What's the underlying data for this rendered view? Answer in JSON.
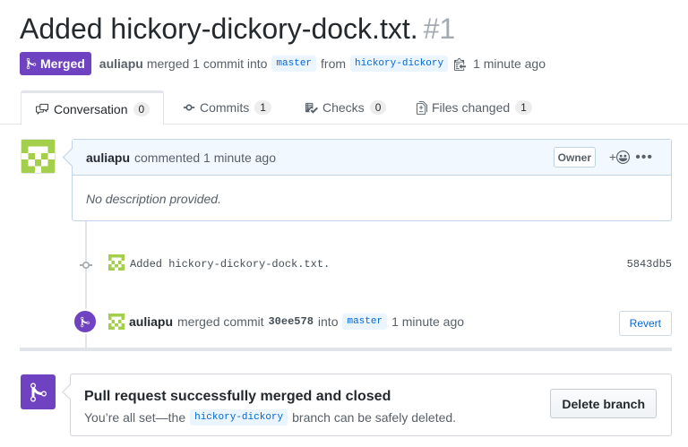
{
  "pr": {
    "title": "Added hickory-dickory-dock.txt.",
    "number": "#1",
    "state": "Merged",
    "author": "auliapu",
    "merge_summary": "merged 1 commit into",
    "base_branch": "master",
    "from_label": "from",
    "head_branch": "hickory-dickory",
    "time": "1 minute ago"
  },
  "tabs": [
    {
      "label": "Conversation",
      "count": "0",
      "icon": "comment-discussion-icon"
    },
    {
      "label": "Commits",
      "count": "1",
      "icon": "git-commit-icon"
    },
    {
      "label": "Checks",
      "count": "0",
      "icon": "checklist-icon"
    },
    {
      "label": "Files changed",
      "count": "1",
      "icon": "file-diff-icon"
    }
  ],
  "comment": {
    "author": "auliapu",
    "action": "commented 1 minute ago",
    "role": "Owner",
    "reaction_plus": "+",
    "body": "No description provided."
  },
  "commit": {
    "message": "Added hickory-dickory-dock.txt.",
    "sha": "5843db5"
  },
  "merge_event": {
    "author": "auliapu",
    "action": "merged commit",
    "sha": "30ee578",
    "into": "into",
    "branch": "master",
    "time": "1 minute ago",
    "revert_label": "Revert"
  },
  "mergebox": {
    "title": "Pull request successfully merged and closed",
    "desc_prefix": "You’re all set—the",
    "branch": "hickory-dickory",
    "desc_suffix": "branch can be safely deleted.",
    "delete_label": "Delete branch"
  },
  "colors": {
    "merged_purple": "#6f42c1",
    "link_blue": "#0366d6",
    "identicon_green": "#a4cf4b"
  }
}
